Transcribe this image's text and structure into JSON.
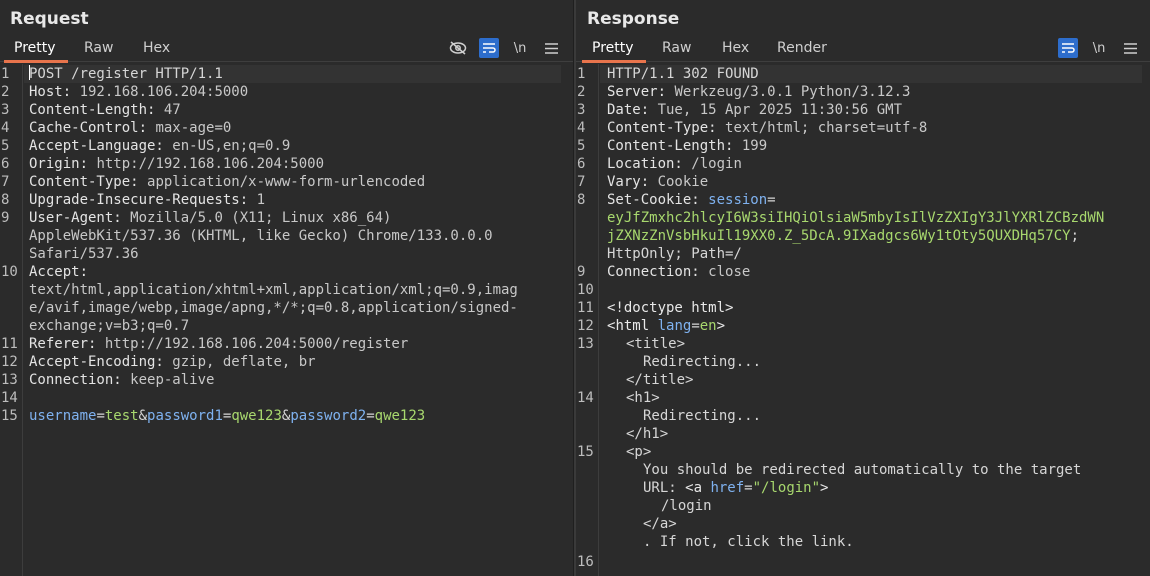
{
  "request": {
    "title": "Request",
    "tabs": [
      {
        "label": "Pretty",
        "active": true
      },
      {
        "label": "Raw",
        "active": false
      },
      {
        "label": "Hex",
        "active": false
      }
    ],
    "tools": [
      "hide-icon",
      "wrap-icon",
      "newline-toggle",
      "menu-icon"
    ],
    "newline_label": "\\n",
    "lines": [
      {
        "n": "1",
        "text": "POST /register HTTP/1.1"
      },
      {
        "n": "2",
        "key": "Host: ",
        "val": "192.168.106.204:5000"
      },
      {
        "n": "3",
        "key": "Content-Length: ",
        "val": "47"
      },
      {
        "n": "4",
        "key": "Cache-Control: ",
        "val": "max-age=0"
      },
      {
        "n": "5",
        "key": "Accept-Language: ",
        "val": "en-US,en;q=0.9"
      },
      {
        "n": "6",
        "key": "Origin: ",
        "val": "http://192.168.106.204:5000"
      },
      {
        "n": "7",
        "key": "Content-Type: ",
        "val": "application/x-www-form-urlencoded"
      },
      {
        "n": "8",
        "key": "Upgrade-Insecure-Requests: ",
        "val": "1"
      },
      {
        "n": "9",
        "key": "User-Agent: ",
        "val": "Mozilla/5.0 (X11; Linux x86_64)",
        "cont": [
          "AppleWebKit/537.36 (KHTML, like Gecko) Chrome/133.0.0.0",
          "Safari/537.36"
        ]
      },
      {
        "n": "10",
        "key": "Accept: ",
        "val": "",
        "cont": [
          "text/html,application/xhtml+xml,application/xml;q=0.9,imag",
          "e/avif,image/webp,image/apng,*/*;q=0.8,application/signed-",
          "exchange;v=b3;q=0.7"
        ]
      },
      {
        "n": "11",
        "key": "Referer: ",
        "val": "http://192.168.106.204:5000/register"
      },
      {
        "n": "12",
        "key": "Accept-Encoding: ",
        "val": "gzip, deflate, br"
      },
      {
        "n": "13",
        "key": "Connection: ",
        "val": "keep-alive"
      },
      {
        "n": "14",
        "text": ""
      }
    ],
    "body_line": {
      "n": "15",
      "p1": "username",
      "e1": "=",
      "v1": "test",
      "a1": "&",
      "p2": "password1",
      "e2": "=",
      "v2": "qwe123",
      "a2": "&",
      "p3": "password2",
      "e3": "=",
      "v3": "qwe123"
    }
  },
  "response": {
    "title": "Response",
    "tabs": [
      {
        "label": "Pretty",
        "active": true
      },
      {
        "label": "Raw",
        "active": false
      },
      {
        "label": "Hex",
        "active": false
      },
      {
        "label": "Render",
        "active": false
      }
    ],
    "newline_label": "\\n",
    "lines": [
      {
        "n": "1",
        "text": "HTTP/1.1 302 FOUND"
      },
      {
        "n": "2",
        "key": "Server: ",
        "val": "Werkzeug/3.0.1 Python/3.12.3"
      },
      {
        "n": "3",
        "key": "Date: ",
        "val": "Tue, 15 Apr 2025 11:30:56 GMT"
      },
      {
        "n": "4",
        "key": "Content-Type: ",
        "val": "text/html; charset=utf-8"
      },
      {
        "n": "5",
        "key": "Content-Length: ",
        "val": "199"
      },
      {
        "n": "6",
        "key": "Location: ",
        "val": "/login"
      },
      {
        "n": "7",
        "key": "Vary: ",
        "val": "Cookie"
      }
    ],
    "cookie": {
      "n": "8",
      "key": "Set-Cookie: ",
      "name": "session",
      "eq": "=",
      "value1": "eyJfZmxhc2hlcyI6W3siIHQiOlsiaW5mbyIsIlVzZXIgY3JlYXRlZCBzdWN",
      "value2": "jZXNzZnVsbHkuIl19XX0.Z_5DcA.9IXadgcs6Wy1tOty5QUXDHq57CY",
      "semi": ";",
      "rest": "HttpOnly; Path=/"
    },
    "conn": {
      "n": "9",
      "key": "Connection: ",
      "val": "close"
    },
    "blank": {
      "n": "10"
    },
    "html": {
      "l11": {
        "n": "11",
        "text": "<!doctype html>"
      },
      "l12": {
        "n": "12",
        "open": "<",
        "tag": "html",
        "attr": " lang",
        "eq": "=",
        "attrval": "en",
        "close": ">"
      },
      "l13": {
        "n": "13",
        "open": "<title>",
        "text": "Redirecting...",
        "close": "</title>"
      },
      "l14": {
        "n": "14",
        "open": "<h1>",
        "text": "Redirecting...",
        "close": "</h1>"
      },
      "l15": {
        "n": "15",
        "open": "<p>",
        "text": "You should be redirected automatically to the target",
        "url_label": "URL: ",
        "a_open": "<a",
        "href": " href",
        "eq": "=",
        "hrefval": "\"/login\"",
        "gt": ">",
        "link": "/login",
        "a_close": "</a>",
        "tail": ". If not, click the link."
      },
      "l16": {
        "n": "16"
      }
    }
  }
}
